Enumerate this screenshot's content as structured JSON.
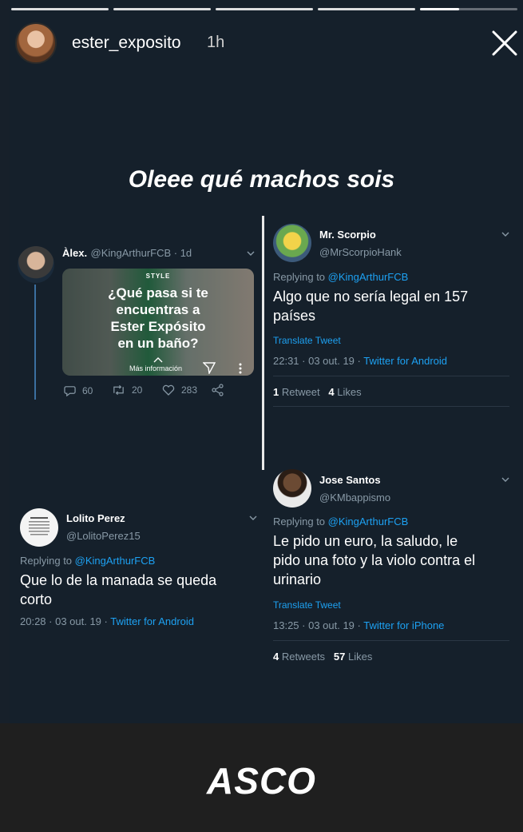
{
  "story": {
    "username": "ester_exposito",
    "time_ago": "1h",
    "headline": "Oleee qué machos sois",
    "footer_caption": "ASCO",
    "progress_segments": 5,
    "active_segment_progress": 0.4
  },
  "tweets": {
    "alex": {
      "name": "Àlex.",
      "handle_time": "@KingArthurFCB · 1d",
      "card": {
        "tag": "STYLE",
        "title_line1": "¿Qué pasa si te",
        "title_line2": "encuentras a",
        "title_line3": "Ester Expósito",
        "title_line4": "en un baño?",
        "more_label": "Más información"
      },
      "replies": "60",
      "retweets": "20",
      "likes": "283"
    },
    "scorpio": {
      "name": "Mr. Scorpio",
      "handle": "@MrScorpioHank",
      "replying_prefix": "Replying to",
      "replying_handle": "@KingArthurFCB",
      "text_line1": "Algo que no sería legal en 157",
      "text_line2": "países",
      "translate": "Translate Tweet",
      "timestamp": "22:31 · 03 out. 19 ·",
      "source": "Twitter for Android",
      "retweets_count": "1",
      "retweets_label": "Retweet",
      "likes_count": "4",
      "likes_label": "Likes"
    },
    "jose": {
      "name": "Jose Santos",
      "handle": "@KMbappismo",
      "replying_prefix": "Replying to",
      "replying_handle": "@KingArthurFCB",
      "text_line1": "Le pido un euro, la saludo, le",
      "text_line2": "pido una foto y la violo contra el",
      "text_line3": "urinario",
      "translate": "Translate Tweet",
      "timestamp": "13:25 · 03 out. 19 ·",
      "source": "Twitter for iPhone",
      "retweets_count": "4",
      "retweets_label": "Retweets",
      "likes_count": "57",
      "likes_label": "Likes"
    },
    "lolito": {
      "name": "Lolito Perez",
      "handle": "@LolitoPerez15",
      "replying_prefix": "Replying to",
      "replying_handle": "@KingArthurFCB",
      "text_line1": "Que lo de la manada se queda",
      "text_line2": "corto",
      "timestamp": "20:28 · 03 out. 19 ·",
      "source": "Twitter for Android"
    }
  },
  "colors": {
    "twitter_blue": "#1da1f2",
    "dim_text": "#8899a6",
    "background": "#15202b"
  },
  "icons": [
    "close-icon",
    "chevron-down-icon",
    "reply-icon",
    "retweet-icon",
    "like-icon",
    "share-icon",
    "send-icon",
    "more-icon"
  ]
}
